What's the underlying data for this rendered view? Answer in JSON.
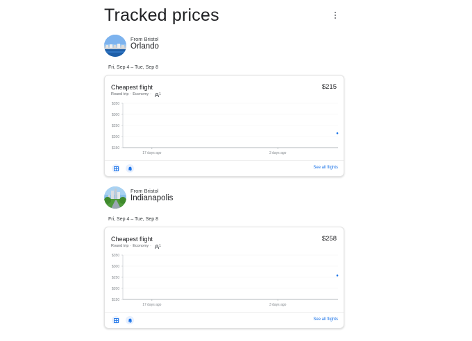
{
  "header": {
    "title": "Tracked prices",
    "more_icon": "more-vert-icon"
  },
  "tracked": [
    {
      "from_label": "From Bristol",
      "destination": "Orlando",
      "dates": "Fri, Sep 4 – Tue, Sep 8",
      "card": {
        "title": "Cheapest flight",
        "trip_type": "Round trip",
        "cabin": "Economy",
        "passengers": "1",
        "price": "$215",
        "see_all": "See all flights"
      },
      "chart_data": {
        "type": "line",
        "y_ticks": [
          "$350",
          "$300",
          "$250",
          "$200",
          "$150"
        ],
        "ylim": [
          150,
          350
        ],
        "x_ticks": [
          "17 days ago",
          "3 days ago"
        ],
        "series": [
          {
            "x": [
              "today"
            ],
            "values": [
              215
            ]
          }
        ],
        "color": "#1a73e8"
      }
    },
    {
      "from_label": "From Bristol",
      "destination": "Indianapolis",
      "dates": "Fri, Sep 4 – Tue, Sep 8",
      "card": {
        "title": "Cheapest flight",
        "trip_type": "Round trip",
        "cabin": "Economy",
        "passengers": "1",
        "price": "$258",
        "see_all": "See all flights"
      },
      "chart_data": {
        "type": "line",
        "y_ticks": [
          "$350",
          "$300",
          "$250",
          "$200",
          "$150"
        ],
        "ylim": [
          150,
          350
        ],
        "x_ticks": [
          "17 days ago",
          "3 days ago"
        ],
        "series": [
          {
            "x": [
              "today"
            ],
            "values": [
              258
            ]
          }
        ],
        "color": "#1a73e8"
      }
    }
  ],
  "footer_icons": [
    "grid-icon",
    "bell-icon"
  ],
  "colors": {
    "accent": "#1a73e8",
    "chip_bg": "#e8f0fe"
  }
}
